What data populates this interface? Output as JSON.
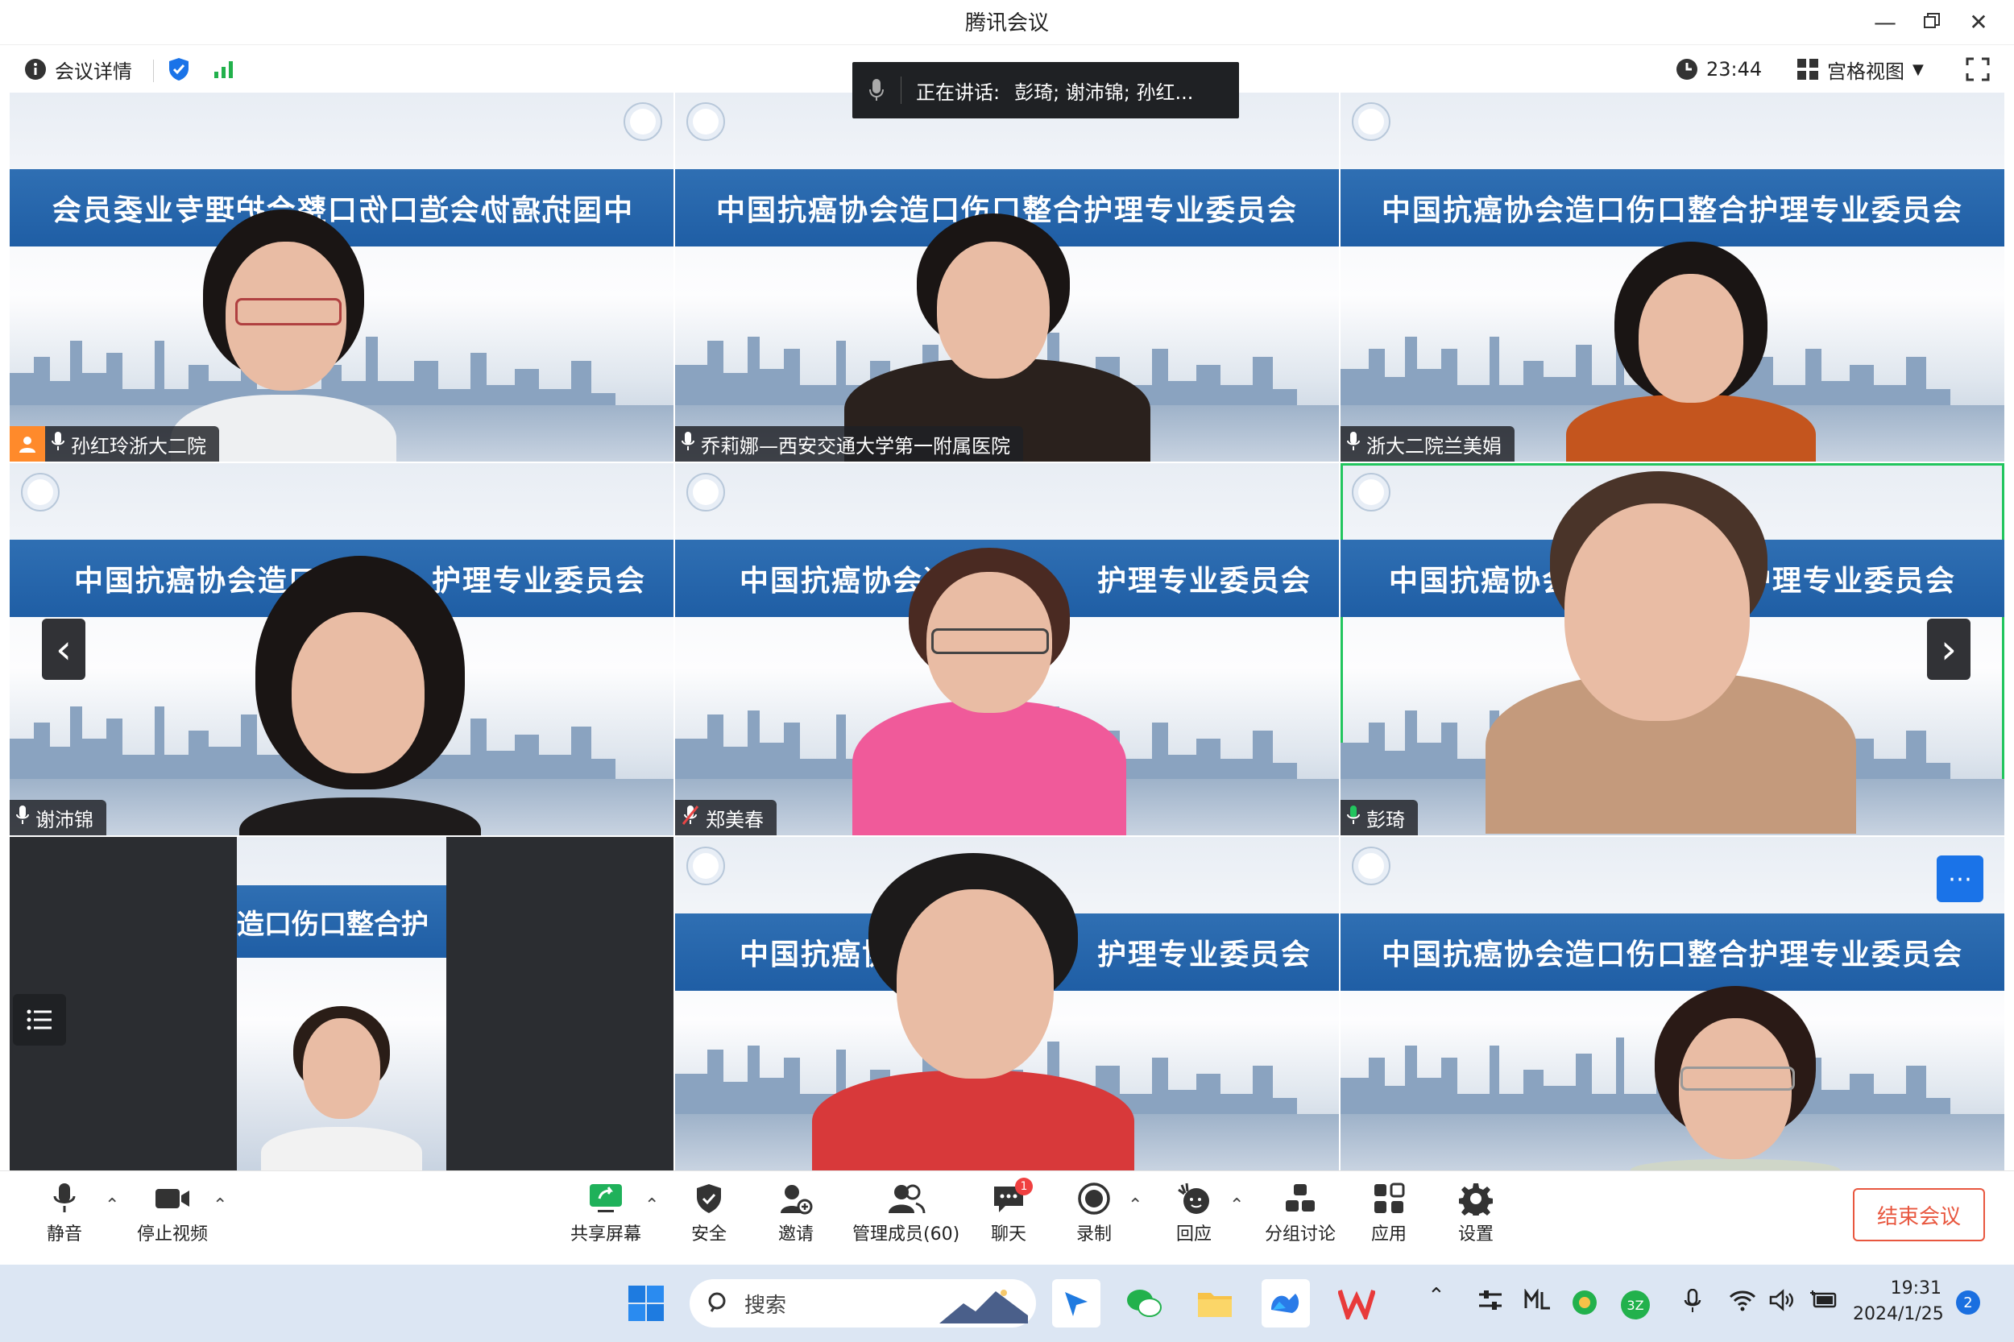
{
  "window": {
    "title": "腾讯会议"
  },
  "infobar": {
    "details_label": "会议详情",
    "timer": "23:44",
    "view_label": "宫格视图"
  },
  "speaking": {
    "prefix": "正在讲话:",
    "names": "彭琦; 谢沛锦; 孙红..."
  },
  "banner_text": "中国抗癌协会造口伤口整合护理专业委员会",
  "banner_partial_left": "中国抗癌协会造口",
  "banner_partial_right": "护理专业委员会",
  "banner_crop": "造口伤口整合护",
  "participants": [
    {
      "name": "孙红玲浙大二院",
      "host": true
    },
    {
      "name": "乔莉娜—西安交通大学第一附属医院"
    },
    {
      "name": "浙大二院兰美娟"
    },
    {
      "name": "谢沛锦"
    },
    {
      "name": "郑美春",
      "muted": true
    },
    {
      "name": "彭琦",
      "active_speaker": true
    }
  ],
  "toolbar": {
    "mute": "静音",
    "stop_video": "停止视频",
    "share": "共享屏幕",
    "security": "安全",
    "invite": "邀请",
    "members": "管理成员(60)",
    "chat": "聊天",
    "chat_badge": "1",
    "record": "录制",
    "react": "回应",
    "breakout": "分组讨论",
    "apps": "应用",
    "settings": "设置",
    "end": "结束会议"
  },
  "taskbar": {
    "search_placeholder": "搜索",
    "time": "19:31",
    "date": "2024/1/25",
    "notification_count": "2"
  },
  "colors": {
    "accent": "#1a73e8",
    "end": "#e8573f",
    "speaker_border": "#22c55e",
    "banner": "#2567ad"
  }
}
